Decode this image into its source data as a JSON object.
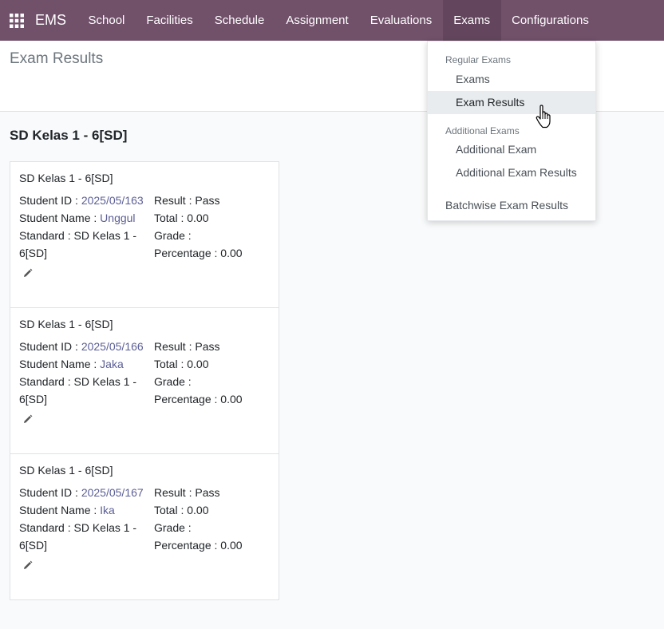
{
  "navbar": {
    "brand": "EMS",
    "items": [
      "School",
      "Facilities",
      "Schedule",
      "Assignment",
      "Evaluations",
      "Exams",
      "Configurations"
    ],
    "active": "Exams",
    "color": "#71506a"
  },
  "page": {
    "title": "Exam Results"
  },
  "group": {
    "title": "SD Kelas 1 - 6[SD]"
  },
  "labels": {
    "student_id": "Student ID : ",
    "student_name": "Student Name : ",
    "standard": "Standard : ",
    "result": "Result : ",
    "total": "Total : ",
    "grade": "Grade : ",
    "percentage": "Percentage : "
  },
  "cards": [
    {
      "title": "SD Kelas 1 - 6[SD]",
      "student_id": "2025/05/163",
      "student_name": "Unggul",
      "standard": "SD Kelas 1 - 6[SD]",
      "result": "Pass",
      "total": "0.00",
      "grade": "",
      "percentage": "0.00"
    },
    {
      "title": "SD Kelas 1 - 6[SD]",
      "student_id": "2025/05/166",
      "student_name": "Jaka",
      "standard": "SD Kelas 1 - 6[SD]",
      "result": "Pass",
      "total": "0.00",
      "grade": "",
      "percentage": "0.00"
    },
    {
      "title": "SD Kelas 1 - 6[SD]",
      "student_id": "2025/05/167",
      "student_name": "Ika",
      "standard": "SD Kelas 1 - 6[SD]",
      "result": "Pass",
      "total": "0.00",
      "grade": "",
      "percentage": "0.00"
    }
  ],
  "dropdown": {
    "regular_header": "Regular Exams",
    "exams": "Exams",
    "exam_results": "Exam Results",
    "additional_header": "Additional Exams",
    "additional_exam": "Additional Exam",
    "additional_exam_results": "Additional Exam Results",
    "batchwise": "Batchwise Exam Results"
  }
}
